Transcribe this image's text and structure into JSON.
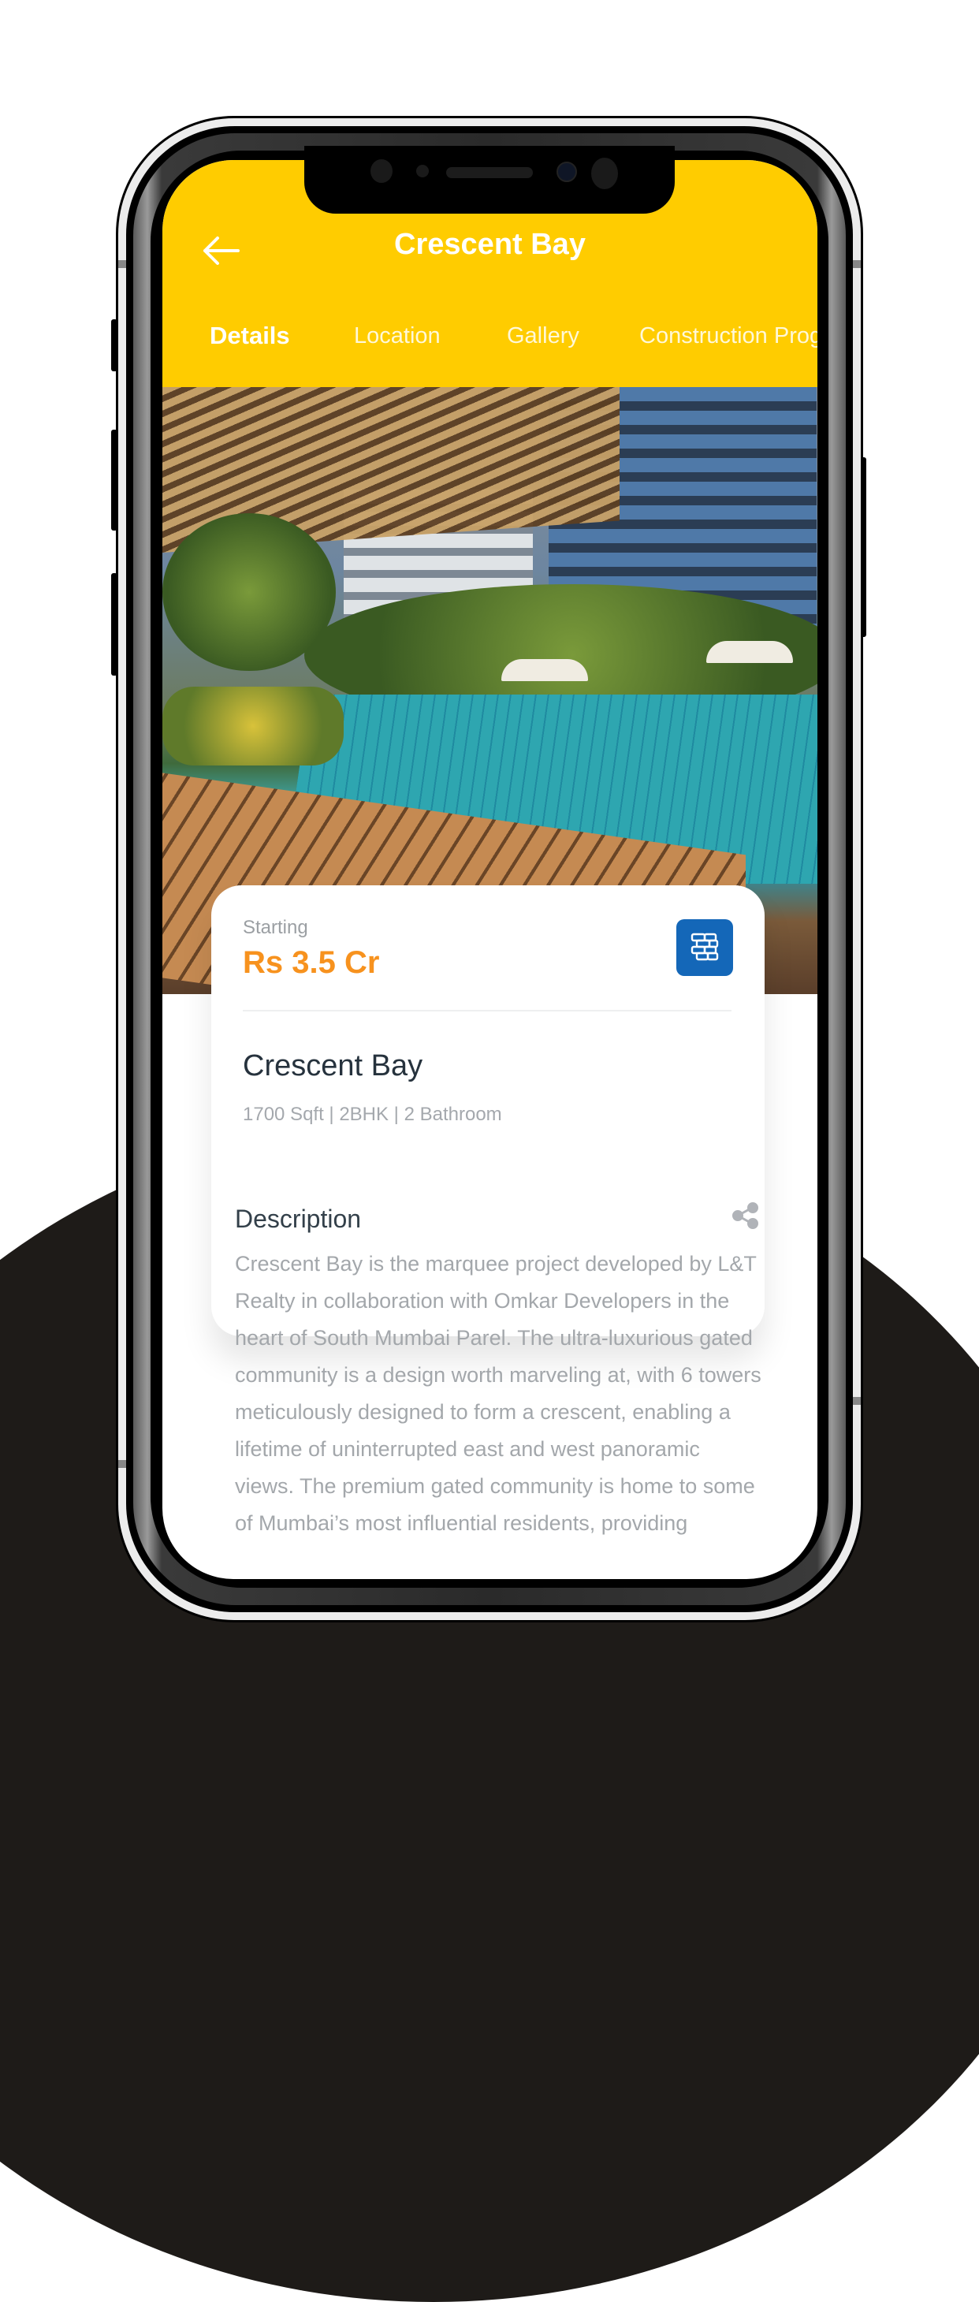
{
  "header": {
    "title": "Crescent Bay",
    "back_icon": "arrow-left-icon"
  },
  "tabs": [
    {
      "label": "Details",
      "active": true
    },
    {
      "label": "Location",
      "active": false
    },
    {
      "label": "Gallery",
      "active": false
    },
    {
      "label": "Construction Progress",
      "active": false
    }
  ],
  "hero_image": {
    "alt": "Poolside pergola with residential towers"
  },
  "card": {
    "starting_label": "Starting",
    "price": "Rs 3.5 Cr",
    "action_icon": "bricks-icon",
    "project_name": "Crescent Bay",
    "specs": "1700 Sqft | 2BHK | 2 Bathroom"
  },
  "description": {
    "title": "Description",
    "share_icon": "share-icon",
    "body": "Crescent Bay is the marquee project developed by L&T Realty in collaboration with Omkar Developers in the heart of South Mumbai Parel. The ultra-luxurious gated community is a design worth marveling at, with 6 towers meticulously designed to form a crescent, enabling a lifetime of uninterrupted east and west panoramic views. The premium gated community is home to some of Mumbai’s most influential residents, providing"
  },
  "colors": {
    "header_bg": "#ffcc00",
    "price": "#f7921e",
    "action_button": "#1467b8",
    "backdrop_dark": "#1e1b18"
  }
}
